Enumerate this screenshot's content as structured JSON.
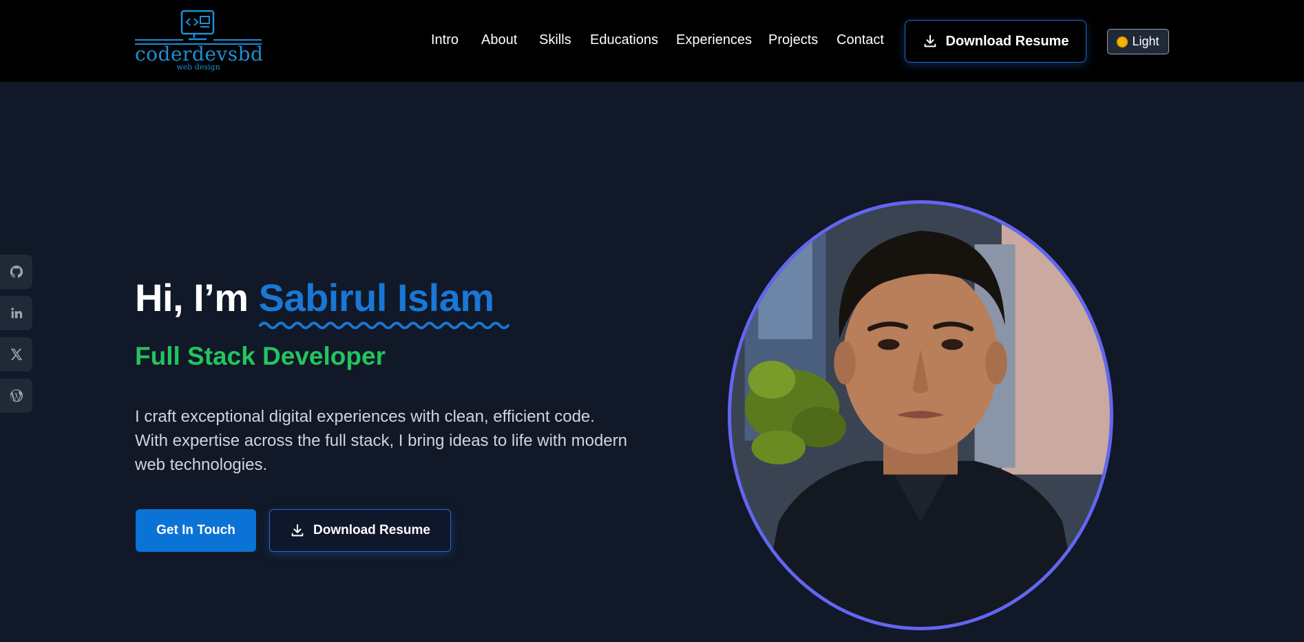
{
  "header": {
    "logo": {
      "name": "coderdevsbd",
      "tagline": "web design"
    },
    "nav": [
      "Intro",
      "About",
      "Skills",
      "Educations",
      "Experiences",
      "Projects",
      "Contact"
    ],
    "download_resume": "Download Resume",
    "theme_toggle": "Light"
  },
  "social": [
    {
      "icon": "github-icon"
    },
    {
      "icon": "linkedin-icon"
    },
    {
      "icon": "x-twitter-icon"
    },
    {
      "icon": "wordpress-icon"
    }
  ],
  "hero": {
    "greeting": "Hi, I’m ",
    "name": "Sabirul Islam",
    "role": "Full Stack Developer",
    "description": "I craft exceptional digital experiences with clean, efficient code. With expertise across the full stack, I bring ideas to life with modern web technologies.",
    "cta_primary": "Get In Touch",
    "cta_secondary": "Download Resume"
  },
  "colors": {
    "accent_blue": "#1977d6",
    "role_green": "#22c55e",
    "portrait_ring": "#6366f1",
    "header_bg": "#000000",
    "page_bg": "#111827"
  }
}
